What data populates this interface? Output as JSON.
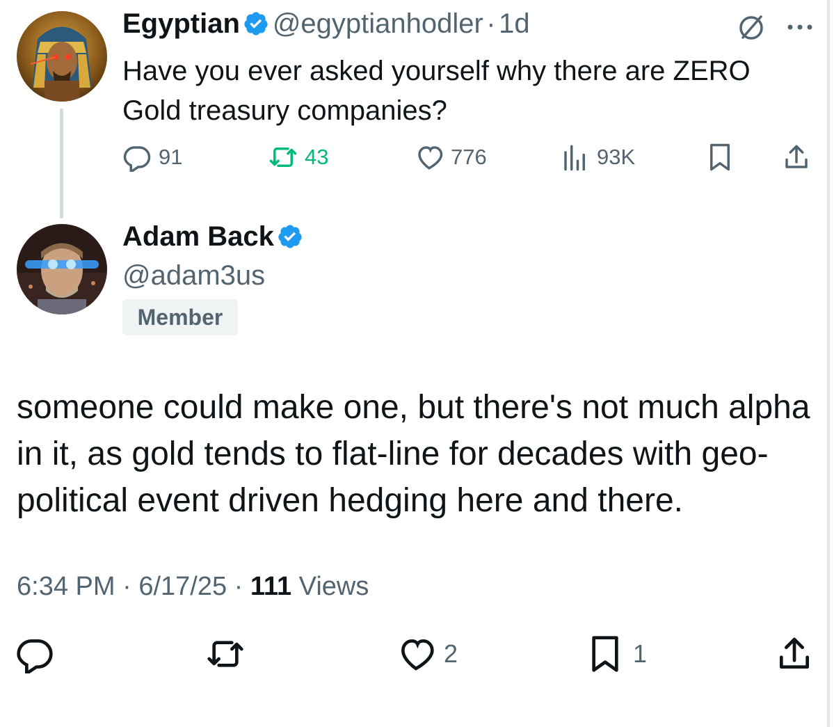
{
  "parent": {
    "name": "Egyptian",
    "handle": "@egyptianhodler",
    "separator": "·",
    "time": "1d",
    "text": "Have you ever asked yourself why there are ZERO Gold treasury companies?",
    "stats": {
      "replies": "91",
      "reposts": "43",
      "likes": "776",
      "views": "93K"
    },
    "repost_color": "#00ba7c"
  },
  "reply": {
    "name": "Adam Back",
    "handle": "@adam3us",
    "badge": "Member",
    "text": "someone could make one, but there's not much alpha in it, as gold tends to flat-line for decades with geo-political event driven hedging here and there.",
    "time": "6:34 PM",
    "date": "6/17/25",
    "separator": "·",
    "views_count": "111",
    "views_label": "Views",
    "stats": {
      "likes": "2",
      "bookmarks": "1"
    }
  },
  "colors": {
    "verified": "#1d9bf0",
    "text_primary": "#0f1419",
    "text_secondary": "#536471"
  },
  "icons": [
    "verified-badge-icon",
    "grok-icon",
    "more-icon",
    "reply-icon",
    "repost-icon",
    "like-icon",
    "views-icon",
    "bookmark-icon",
    "share-icon"
  ]
}
